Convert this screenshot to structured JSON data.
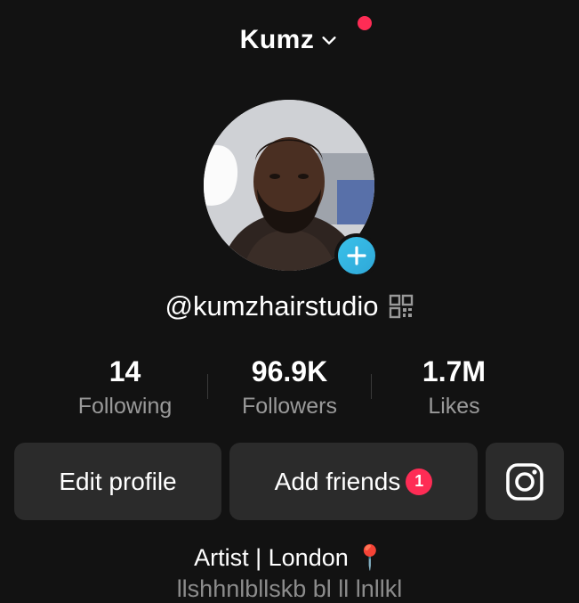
{
  "header": {
    "account_name": "Kumz"
  },
  "profile": {
    "username": "@kumzhairstudio",
    "bio": "Artist | London 📍",
    "bio_next_line": "llshhnlbllskb bl ll lnllkl"
  },
  "stats": [
    {
      "value": "14",
      "label": "Following"
    },
    {
      "value": "96.9K",
      "label": "Followers"
    },
    {
      "value": "1.7M",
      "label": "Likes"
    }
  ],
  "buttons": {
    "edit_profile": "Edit profile",
    "add_friends": "Add friends",
    "add_friends_badge": "1"
  },
  "colors": {
    "background": "#121212",
    "notification": "#fe2c55",
    "add_button": "#39c1ea",
    "button_bg": "#2b2b2b"
  },
  "icons": {
    "account_switch": "chevron-down-icon",
    "avatar_add": "plus-icon",
    "qr": "qr-code-icon",
    "social": "instagram-icon"
  }
}
